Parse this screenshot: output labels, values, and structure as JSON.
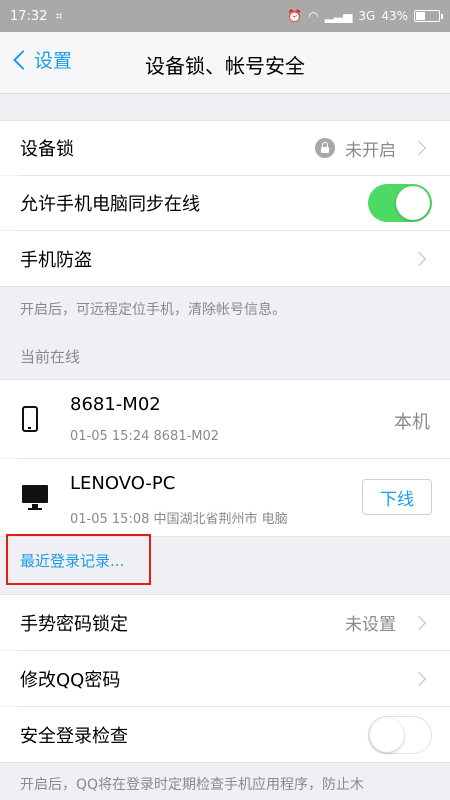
{
  "status_bar": {
    "time": "17:32",
    "network": "3G",
    "battery": "43%",
    "battery_level": 0.43
  },
  "nav": {
    "back_label": "设置",
    "title": "设备锁、帐号安全"
  },
  "section1": {
    "device_lock": {
      "label": "设备锁",
      "value": "未开启"
    },
    "sync_online": {
      "label": "允许手机电脑同步在线",
      "enabled": true
    },
    "anti_theft": {
      "label": "手机防盗"
    },
    "hint": "开启后，可远程定位手机，清除帐号信息。"
  },
  "online": {
    "section_label": "当前在线",
    "devices": [
      {
        "name": "8681-M02",
        "meta": "01-05 15:24 8681-M02",
        "tag": "本机",
        "icon": "phone-icon"
      },
      {
        "name": "LENOVO-PC",
        "meta": "01-05 15:08 中国湖北省荆州市 电脑",
        "action": "下线",
        "icon": "desktop-icon"
      }
    ],
    "recent_link": "最近登录记录..."
  },
  "section2": {
    "gesture_lock": {
      "label": "手势密码锁定",
      "value": "未设置"
    },
    "change_password": {
      "label": "修改QQ密码"
    },
    "safe_login_check": {
      "label": "安全登录检查",
      "enabled": false
    },
    "hint": "开启后，QQ将在登录时定期检查手机应用程序，防止木"
  },
  "colors": {
    "accent": "#1a9ee8",
    "toggle_on": "#4cd964",
    "highlight_box": "#e21b1b"
  }
}
